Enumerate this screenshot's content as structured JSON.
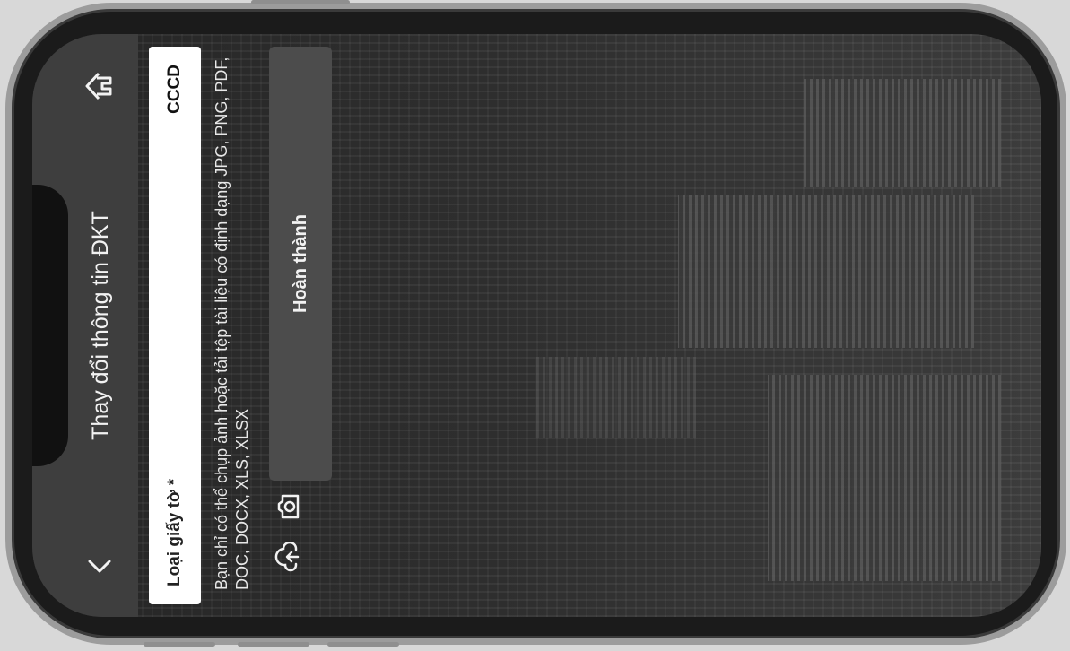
{
  "header": {
    "title": "Thay đổi thông tin ĐKT",
    "back_icon": "chevron-left-icon",
    "home_icon": "home-icon"
  },
  "form": {
    "doc_type_label": "Loại giấy tờ *",
    "doc_type_value": "CCCD",
    "hint": "Bạn chỉ có thể chụp ảnh hoặc tải tệp tài liệu có định dạng JPG, PNG, PDF, DOC, DOCX, XLS, XLSX",
    "upload_icon": "cloud-upload-icon",
    "camera_icon": "camera-icon",
    "done_label": "Hoàn thành"
  },
  "colors": {
    "header_bg": "#3e3e3e",
    "button_bg": "#4c4c4c",
    "text_light": "#f2f2f2"
  }
}
